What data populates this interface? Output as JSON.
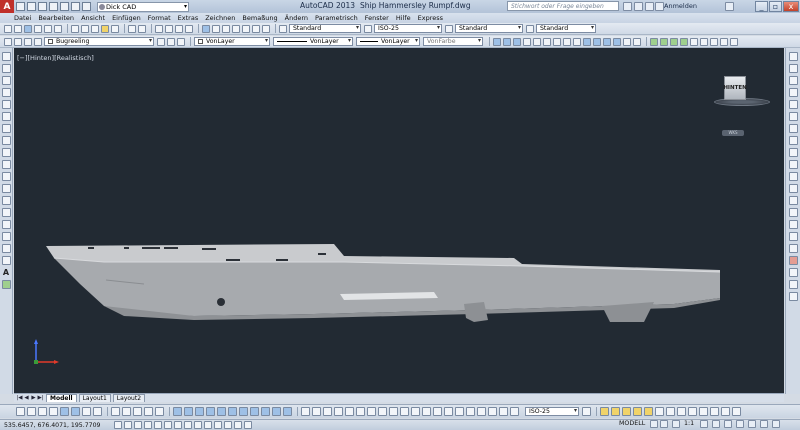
{
  "title": {
    "app_button": "A",
    "workspace": "Dick CAD",
    "app_name": "AutoCAD 2013",
    "file_name": "Ship Hammersley Rumpf.dwg",
    "search_placeholder": "Stichwort oder Frage eingeben",
    "login": "Anmelden",
    "window_buttons": [
      "_",
      "▫",
      "x"
    ]
  },
  "menu": [
    "Datei",
    "Bearbeiten",
    "Ansicht",
    "Einfügen",
    "Format",
    "Extras",
    "Zeichnen",
    "Bemaßung",
    "Ändern",
    "Parametrisch",
    "Fenster",
    "Hilfe",
    "Express"
  ],
  "toolbar1": {
    "text_style": "Standard",
    "dim_style": "ISO-25",
    "table_style": "Standard",
    "mleader_style": "Standard"
  },
  "toolbar2": {
    "layer": "Bugreeling",
    "color": "VonLayer",
    "linetype": "VonLayer",
    "lineweight": "VonLayer",
    "plotstyle": "VonFarbe"
  },
  "viewport": {
    "label": "[−][Hinten][Realistisch]",
    "viewcube_face": "HINTEN",
    "wcs_badge": "WKS"
  },
  "tabs": {
    "nav": [
      "|◀",
      "◀",
      "▶",
      "▶|"
    ],
    "items": [
      "Modell",
      "Layout1",
      "Layout2"
    ]
  },
  "cmdrow": {
    "dim_style": "ISO-25"
  },
  "status": {
    "coordinates": "535.6457, 676.4071, 195.7709",
    "model": "MODELL",
    "scale": "1:1"
  },
  "colors": {
    "viewport_bg": "#222a33",
    "hull": "#a7aaae",
    "deck": "#c9cbce",
    "app_red": "#c0302a"
  }
}
